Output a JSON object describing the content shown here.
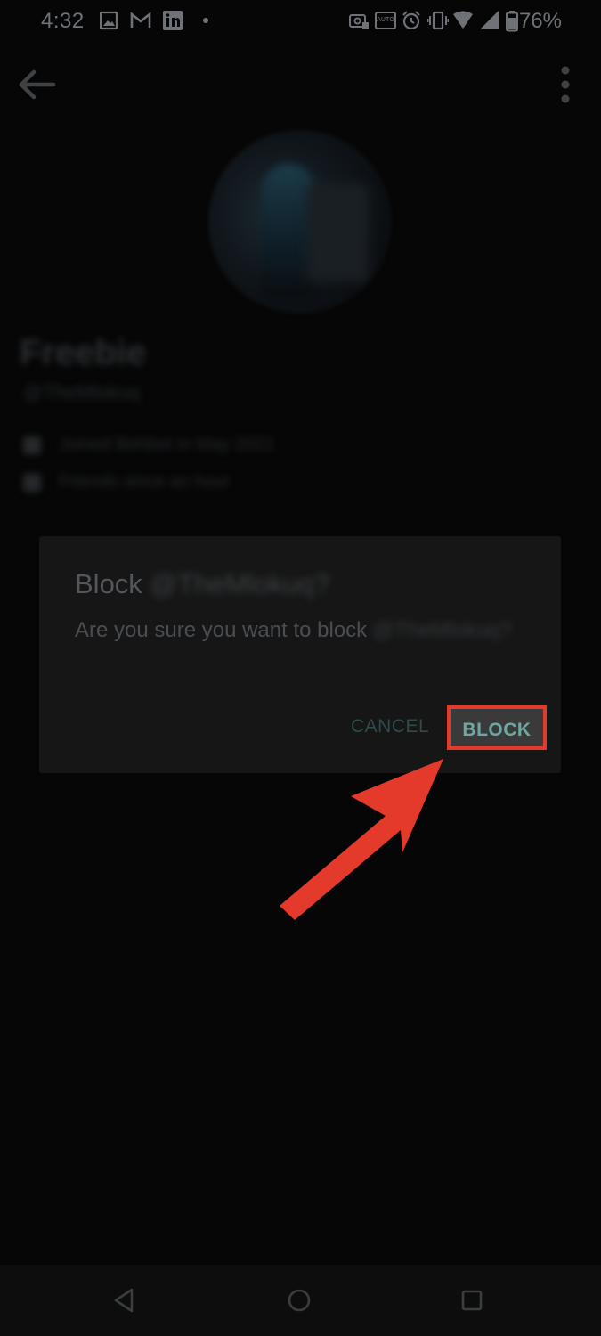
{
  "status_bar": {
    "time": "4:32",
    "battery_percent": "76%",
    "notification_icons": [
      "image-icon",
      "gmail-icon",
      "linkedin-icon",
      "dot-icon"
    ],
    "system_icons": [
      "camera-lock-icon",
      "auto-brightness-icon",
      "alarm-icon",
      "vibrate-icon",
      "wifi-icon",
      "signal-icon",
      "battery-icon"
    ]
  },
  "toolbar": {
    "back_icon": "back-arrow-icon",
    "menu_icon": "more-vertical-icon"
  },
  "dialog": {
    "title_prefix": "Block",
    "title_username": "@TheMlokuq?",
    "message_prefix": "Are you sure you want to block",
    "message_username": "@TheMlokuq?",
    "cancel_label": "CANCEL",
    "block_label": "BLOCK"
  },
  "colors": {
    "highlight_annotation": "#e43a2c",
    "dialog_button_text": "#6ea8a3",
    "dialog_background": "#161616"
  },
  "nav_bar": {
    "icons": [
      "back-triangle-icon",
      "home-circle-icon",
      "recents-square-icon"
    ]
  }
}
